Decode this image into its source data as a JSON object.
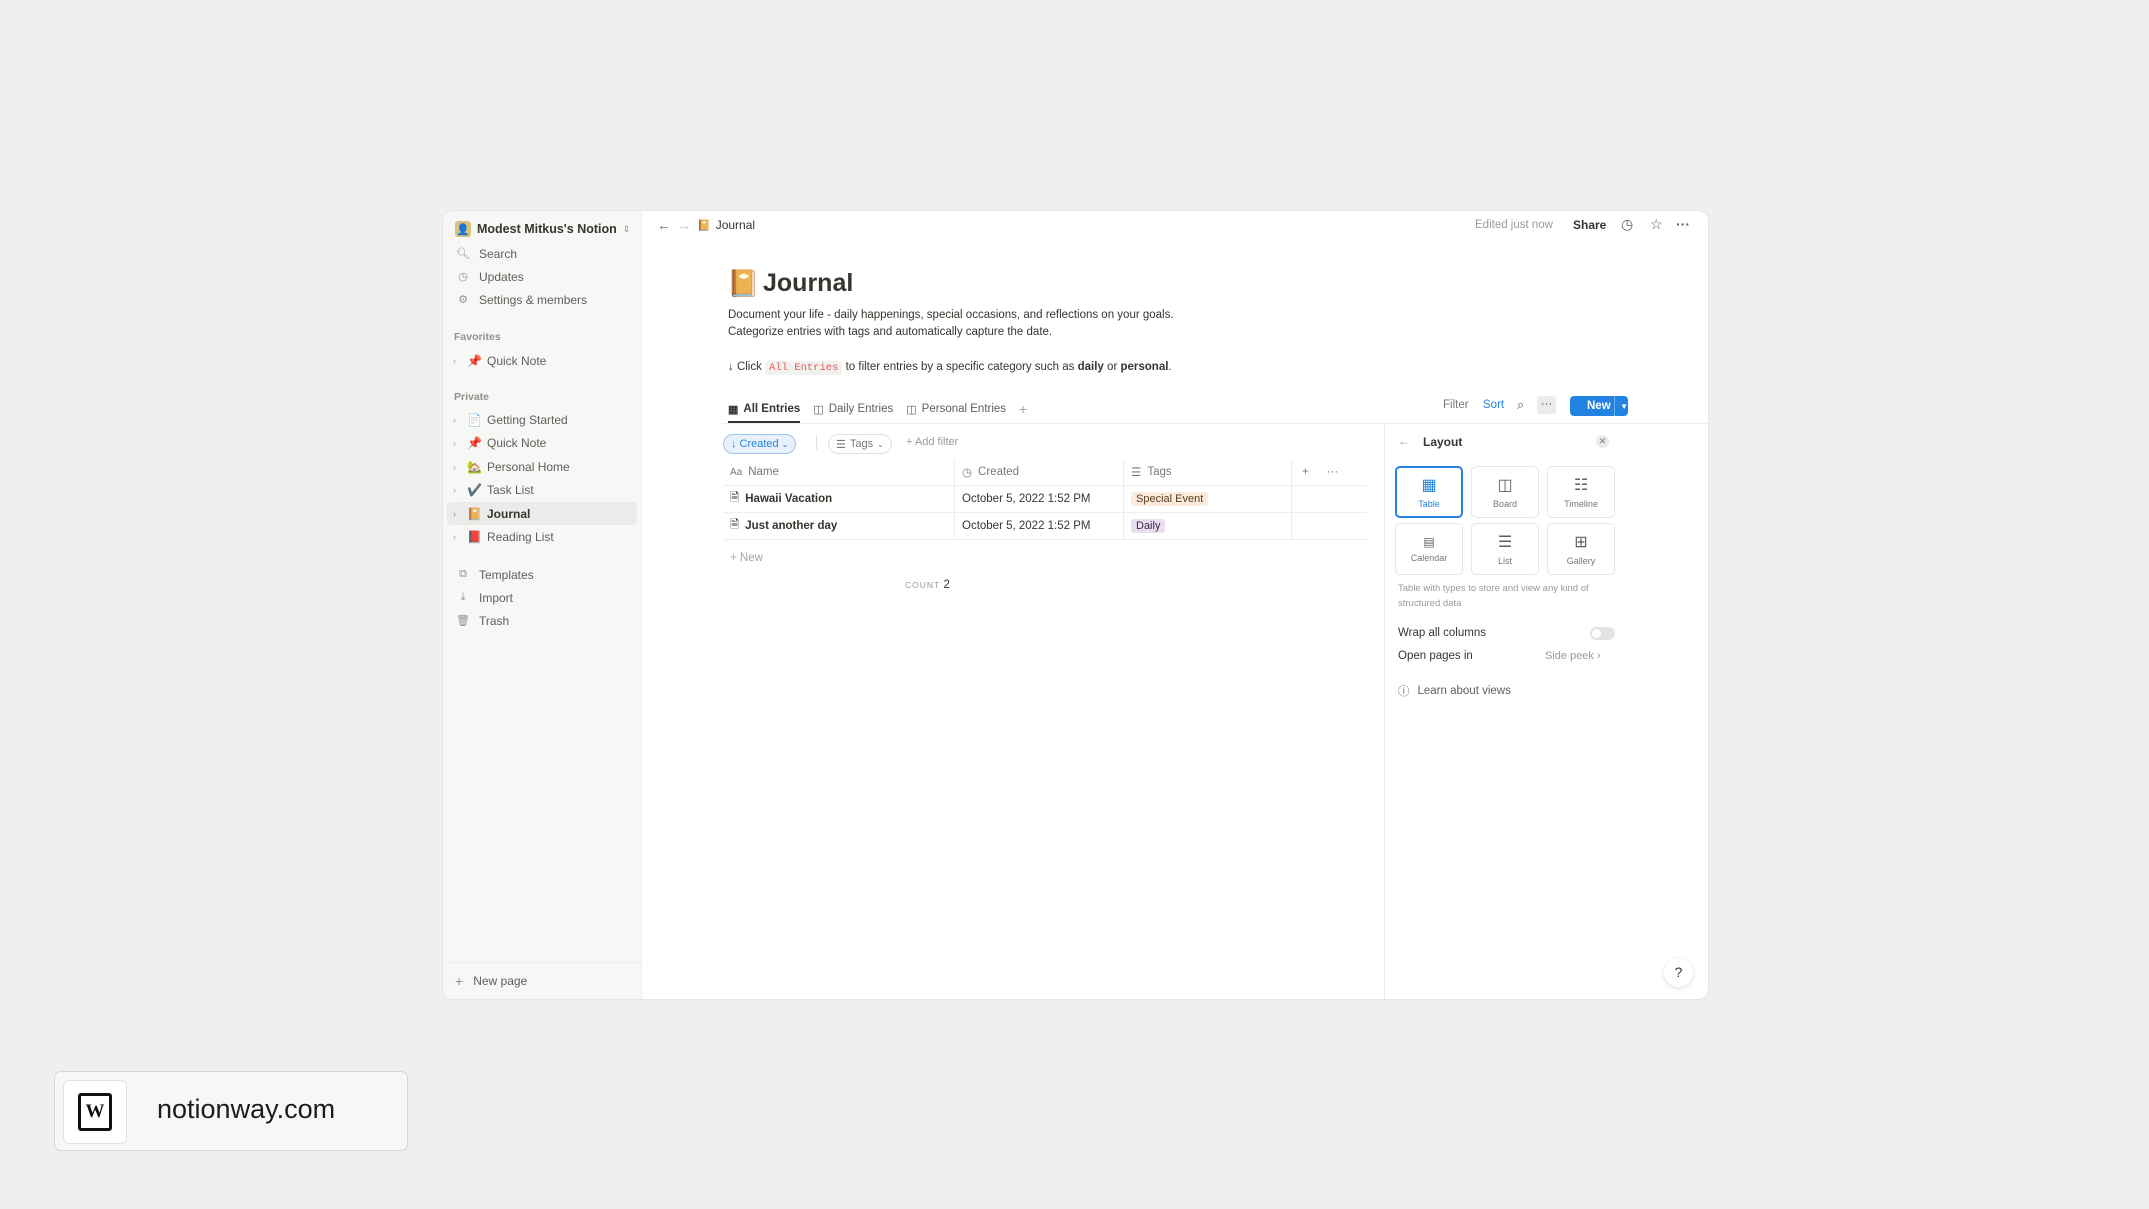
{
  "sidebar": {
    "workspace": "Modest Mitkus's Notion",
    "top_items": [
      {
        "label": "Search",
        "icon": "search-icon"
      },
      {
        "label": "Updates",
        "icon": "clock-icon"
      },
      {
        "label": "Settings & members",
        "icon": "gear-icon"
      }
    ],
    "favorites_label": "Favorites",
    "favorites": [
      {
        "label": "Quick Note",
        "emoji": "📌"
      }
    ],
    "private_label": "Private",
    "private": [
      {
        "label": "Getting Started",
        "emoji": "📄"
      },
      {
        "label": "Quick Note",
        "emoji": "📌"
      },
      {
        "label": "Personal Home",
        "emoji": "🏡"
      },
      {
        "label": "Task List",
        "emoji": "✔️"
      },
      {
        "label": "Journal",
        "emoji": "📔"
      },
      {
        "label": "Reading List",
        "emoji": "📕"
      }
    ],
    "bottom_items": [
      {
        "label": "Templates",
        "icon": "templates-icon"
      },
      {
        "label": "Import",
        "icon": "import-icon"
      },
      {
        "label": "Trash",
        "icon": "trash-icon"
      }
    ],
    "new_page": "New page"
  },
  "topbar": {
    "breadcrumb": "Journal",
    "edited": "Edited just now",
    "share": "Share"
  },
  "page": {
    "icon": "📔",
    "title": "Journal",
    "desc_line1": "Document your life - daily happenings, special occasions, and reflections on your goals.",
    "desc_line2": "Categorize entries with tags and automatically capture the date.",
    "hint_prefix": "↓ Click",
    "hint_code": "All Entries",
    "hint_mid": "to filter entries by a specific category such as",
    "hint_b1": "daily",
    "hint_or": "or",
    "hint_b2": "personal",
    "hint_end": "."
  },
  "views": {
    "tabs": [
      {
        "label": "All Entries",
        "active": true
      },
      {
        "label": "Daily Entries",
        "active": false
      },
      {
        "label": "Personal Entries",
        "active": false
      }
    ],
    "filter": "Filter",
    "sort": "Sort",
    "new": "New"
  },
  "filters": {
    "created": "Created",
    "tags": "Tags",
    "add_filter": "Add filter"
  },
  "table": {
    "headers": {
      "name": "Name",
      "created": "Created",
      "tags": "Tags"
    },
    "rows": [
      {
        "name": "Hawaii Vacation",
        "created": "October 5, 2022 1:52 PM",
        "tag": "Special Event"
      },
      {
        "name": "Just another day",
        "created": "October 5, 2022 1:52 PM",
        "tag": "Daily"
      }
    ],
    "add_row": "New",
    "count_label": "COUNT",
    "count_value": "2"
  },
  "layout_panel": {
    "title": "Layout",
    "options": [
      {
        "label": "Table",
        "icon": "table-icon",
        "selected": true
      },
      {
        "label": "Board",
        "icon": "board-icon",
        "selected": false
      },
      {
        "label": "Timeline",
        "icon": "timeline-icon",
        "selected": false
      },
      {
        "label": "Calendar",
        "icon": "calendar-icon",
        "selected": false
      },
      {
        "label": "List",
        "icon": "list-icon",
        "selected": false
      },
      {
        "label": "Gallery",
        "icon": "gallery-icon",
        "selected": false
      }
    ],
    "description": "Table with types to store and view any kind of structured data",
    "wrap_label": "Wrap all columns",
    "wrap_on": false,
    "open_label": "Open pages in",
    "open_value": "Side peek",
    "learn": "Learn about views"
  },
  "brand": {
    "text": "notionway.com",
    "logo_letter": "W"
  },
  "colors": {
    "accent": "#2383e2",
    "sidebar_bg": "#f7f7f5",
    "page_bg": "#efefee"
  }
}
